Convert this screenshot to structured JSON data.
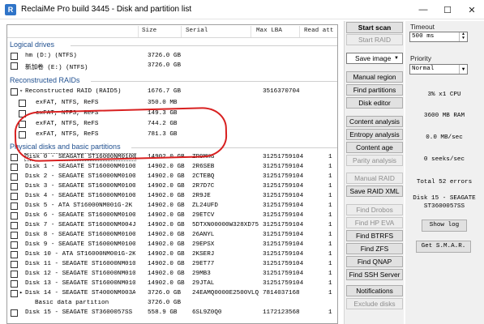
{
  "window": {
    "title": "ReclaiMe Pro build 3445 - Disk and partition list",
    "app_icon": "R",
    "minimize": "—",
    "maximize": "☐",
    "close": "✕"
  },
  "columns": {
    "size": "Size",
    "serial": "Serial",
    "max_lba": "Max LBA",
    "reads": "Read att"
  },
  "logical": {
    "title": "Logical drives",
    "rows": [
      {
        "name": "hm (D:) (NTFS)",
        "size": "3726.0 GB"
      },
      {
        "name": "新加卷 (E:) (NTFS)",
        "size": "3726.0 GB"
      }
    ]
  },
  "raids": {
    "title": "Reconstructed RAIDs",
    "rows": [
      {
        "name": "Reconstructed RAID (RAID5)",
        "size": "1676.7 GB",
        "lba": "3516370704"
      },
      {
        "name": "exFAT, NTFS, ReFS",
        "size": "350.0 MB"
      },
      {
        "name": "exFAT, NTFS, ReFS",
        "size": "149.3 GB"
      },
      {
        "name": "exFAT, NTFS, ReFS",
        "size": "744.2 GB"
      },
      {
        "name": "exFAT, NTFS, ReFS",
        "size": "781.3 GB"
      }
    ]
  },
  "physical": {
    "title": "Physical disks and basic partitions",
    "rows": [
      {
        "name": "Disk 0 - SEAGATE ST16000NM0100",
        "size": "14902.0 GB",
        "serial": "ZR9MHG",
        "lba": "31251759104",
        "reads": "1"
      },
      {
        "name": "Disk 1 - SEAGATE ST16000NM0100",
        "size": "14902.0 GB",
        "serial": "2R6SEB",
        "lba": "31251759104",
        "reads": "1"
      },
      {
        "name": "Disk 2 - SEAGATE ST16000NM0100",
        "size": "14902.0 GB",
        "serial": "2CTEBQ",
        "lba": "31251759104",
        "reads": "1"
      },
      {
        "name": "Disk 3 - SEAGATE ST16000NM0100",
        "size": "14902.0 GB",
        "serial": "2R7D7C",
        "lba": "31251759104",
        "reads": "1"
      },
      {
        "name": "Disk 4 - SEAGATE ST16000NM0100",
        "size": "14902.0 GB",
        "serial": "2R9JE",
        "lba": "31251759104",
        "reads": "1"
      },
      {
        "name": "Disk 5 - ATA ST16000NM001G-2K",
        "size": "14902.0 GB",
        "serial": "ZL24UFD",
        "lba": "31251759104",
        "reads": "1"
      },
      {
        "name": "Disk 6 - SEAGATE ST16000NM0100",
        "size": "14902.0 GB",
        "serial": "29ETCV",
        "lba": "31251759104",
        "reads": "1"
      },
      {
        "name": "Disk 7 - SEAGATE ST16000NM004J",
        "size": "14902.0 GB",
        "serial": "5DTXN00000W328XD75",
        "lba": "31251759104",
        "reads": "1"
      },
      {
        "name": "Disk 8 - SEAGATE ST16000NM0100",
        "size": "14902.0 GB",
        "serial": "26ANYL",
        "lba": "31251759104",
        "reads": "1"
      },
      {
        "name": "Disk 9 - SEAGATE ST16000NM0100",
        "size": "14902.0 GB",
        "serial": "29EPSX",
        "lba": "31251759104",
        "reads": "1"
      },
      {
        "name": "Disk 10 - ATA ST16000NM001G-2K",
        "size": "14902.0 GB",
        "serial": "2KSERJ",
        "lba": "31251759104",
        "reads": "1"
      },
      {
        "name": "Disk 11 - SEAGATE ST16000NM0100",
        "size": "14902.0 GB",
        "serial": "29ET77",
        "lba": "31251759104",
        "reads": "1"
      },
      {
        "name": "Disk 12 - SEAGATE ST16000NM0100",
        "size": "14902.0 GB",
        "serial": "29MB3",
        "lba": "31251759104",
        "reads": "1"
      },
      {
        "name": "Disk 13 - SEAGATE ST16000NM0100",
        "size": "14902.0 GB",
        "serial": "29JTAL",
        "lba": "31251759104",
        "reads": "1"
      },
      {
        "name": "Disk 14 - SEAGATE ST4000NM003A",
        "size": "3726.0 GB",
        "serial": "24EAMQ0000E2500VLQ",
        "lba": "7814037168",
        "reads": "1"
      },
      {
        "name": "Basic data partition",
        "size": "3726.0 GB",
        "serial": "",
        "lba": "",
        "reads": ""
      },
      {
        "name": "Disk 15 - SEAGATE ST3600057SS",
        "size": "558.9 GB",
        "serial": "6SL9Z0Q0",
        "lba": "1172123568",
        "reads": "1"
      }
    ]
  },
  "buttons": {
    "start_scan": "Start scan",
    "start_raid": "Start RAID",
    "save_image": "Save image",
    "manual_region": "Manual region",
    "find_partitions": "Find partitions",
    "disk_editor": "Disk editor",
    "content_analysis": "Content analysis",
    "entropy_analysis": "Entropy analysis",
    "content_age": "Content age",
    "parity_analysis": "Parity analysis",
    "manual_raid": "Manual RAID",
    "save_raid_xml": "Save RAID XML",
    "find_drobos": "Find Drobos",
    "find_hp_eva": "Find HP EVA",
    "find_btrfs": "Find BTRFS",
    "find_zfs": "Find ZFS",
    "find_qnap": "Find QNAP",
    "find_ssh_server": "Find SSH Server",
    "notifications": "Notifications",
    "exclude_disks": "Exclude disks"
  },
  "status": {
    "timeout_label": "Timeout",
    "timeout_value": "500 ms",
    "priority_label": "Priority",
    "priority_value": "Normal",
    "cpu": "3% x1 CPU",
    "ram": "3600 MB RAM",
    "speed": "0.0 MB/sec",
    "seeks": "0 seeks/sec",
    "errors": "Total 52 errors",
    "disk_line1": "Disk 15 - SEAGATE",
    "disk_line2": "ST3600057SS",
    "show_log": "Show log",
    "get_smart": "Get S.M.A.R."
  },
  "colors": {
    "group_header": "#1f4f8f",
    "annotation": "#d82020",
    "panel_bg": "#f0f0f0"
  }
}
